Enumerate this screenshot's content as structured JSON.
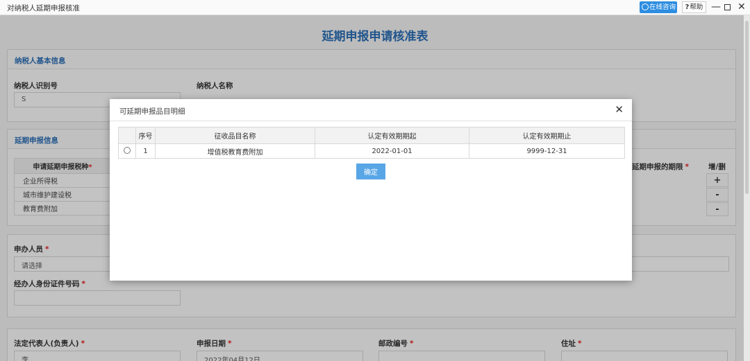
{
  "window": {
    "title": "对纳税人延期申报核准",
    "online_label": "在线咨询",
    "help_label": "帮助",
    "min_glyph": "—",
    "close_glyph": "✕"
  },
  "form": {
    "page_title": "延期申报申请核准表",
    "taxpayer_section": {
      "heading": "纳税人基本信息",
      "id_label": "纳税人识别号",
      "id_value": "S",
      "name_label": "纳税人名称"
    },
    "deferral_section": {
      "heading": "延期申报信息",
      "col_tax_type": "申请延期申报税种",
      "col_deadline": "延期申报的期限",
      "col_add_del": "增/删",
      "rows": [
        "企业所得税",
        "城市维护建设税",
        "教育费附加"
      ],
      "signs": [
        "+",
        "-",
        "-"
      ]
    },
    "applicant_label": "申办人员",
    "applicant_value": "请选择",
    "applicant_id_label": "经办人身份证件号码",
    "legal_rep_label": "法定代表人(负责人)",
    "legal_rep_value": "李",
    "apply_date_label": "申报日期",
    "apply_date_value": "2022年04月12日",
    "postcode_label": "邮政编号",
    "address_label": "住址"
  },
  "modal": {
    "title": "可延期申报品目明细",
    "close_glyph": "✕",
    "columns": [
      "序号",
      "征收品目名称",
      "认定有效期期起",
      "认定有效期期止"
    ],
    "rows": [
      {
        "index": "1",
        "item_name": "增值税教育费附加",
        "start": "2022-01-01",
        "end": "9999-12-31"
      }
    ],
    "confirm_label": "确定"
  }
}
